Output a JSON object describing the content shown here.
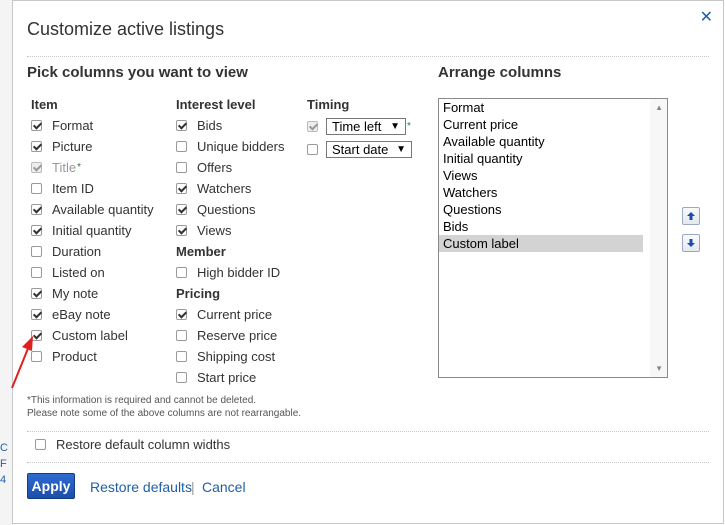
{
  "page_edge": {
    "fragments": [
      "C",
      "F",
      "4"
    ]
  },
  "dialog": {
    "title": "Customize active listings",
    "close_glyph": "✕"
  },
  "pick": {
    "heading": "Pick columns you want to view",
    "item": {
      "heading": "Item",
      "options": [
        {
          "label": "Format",
          "checked": true
        },
        {
          "label": "Picture",
          "checked": true
        },
        {
          "label": "Title",
          "checked": true,
          "disabled": true,
          "required": true
        },
        {
          "label": "Item ID",
          "checked": false
        },
        {
          "label": "Available quantity",
          "checked": true
        },
        {
          "label": "Initial quantity",
          "checked": true
        },
        {
          "label": "Duration",
          "checked": false
        },
        {
          "label": "Listed on",
          "checked": false
        },
        {
          "label": "My note",
          "checked": true
        },
        {
          "label": "eBay note",
          "checked": true
        },
        {
          "label": "Custom label",
          "checked": true
        },
        {
          "label": "Product",
          "checked": false
        }
      ]
    },
    "interest": {
      "heading": "Interest level",
      "options": [
        {
          "label": "Bids",
          "checked": true
        },
        {
          "label": "Unique bidders",
          "checked": false
        },
        {
          "label": "Offers",
          "checked": false
        },
        {
          "label": "Watchers",
          "checked": true
        },
        {
          "label": "Questions",
          "checked": true
        },
        {
          "label": "Views",
          "checked": true
        }
      ]
    },
    "member": {
      "heading": "Member",
      "options": [
        {
          "label": "High bidder ID",
          "checked": false
        }
      ]
    },
    "pricing": {
      "heading": "Pricing",
      "options": [
        {
          "label": "Current price",
          "checked": true
        },
        {
          "label": "Reserve price",
          "checked": false
        },
        {
          "label": "Shipping cost",
          "checked": false
        },
        {
          "label": "Start price",
          "checked": false
        }
      ]
    },
    "timing": {
      "heading": "Timing",
      "time_left": {
        "checked": true,
        "disabled": true,
        "value": "Time left",
        "required": true
      },
      "start_date": {
        "checked": false,
        "value": "Start date"
      }
    },
    "required_marker": "*"
  },
  "arrange": {
    "heading": "Arrange columns",
    "items": [
      "Format",
      "Current price",
      "Available quantity",
      "Initial quantity",
      "Views",
      "Watchers",
      "Questions",
      "Bids",
      "Custom label"
    ],
    "selected_index": 8
  },
  "notes": {
    "line1": "*This information is required and cannot be deleted.",
    "line2": "Please note some of the above columns are not rearrangable."
  },
  "restore_widths": {
    "label": "Restore default column widths",
    "checked": false
  },
  "footer": {
    "apply_label": "Apply",
    "restore_defaults_label": "Restore defaults",
    "separator": "|",
    "cancel_label": "Cancel"
  },
  "colors": {
    "link": "#1f5fa8",
    "apply_button": "#1c4ea8",
    "required_star": "#2a7d2a",
    "annotation_arrow": "#e02020",
    "selected_row": "#d3d3d3"
  }
}
